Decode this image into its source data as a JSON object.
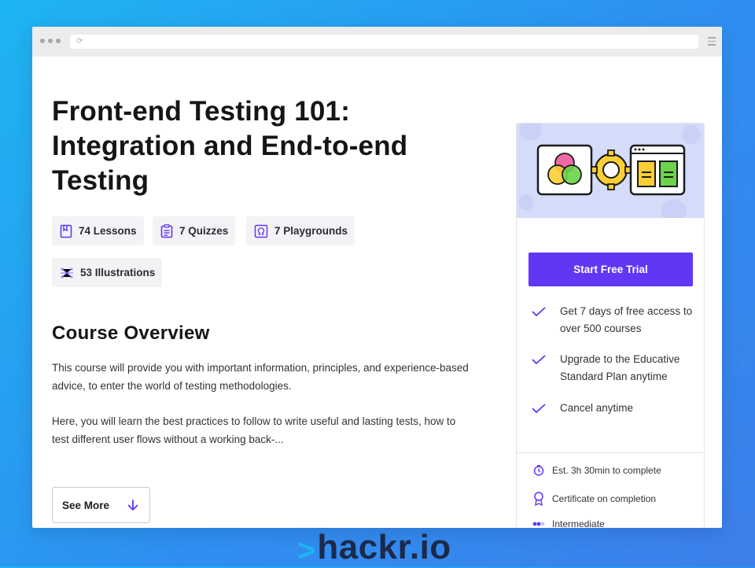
{
  "course": {
    "title": "Front-end Testing 101: Integration and End-to-end Testing",
    "stats": [
      {
        "label": "74 Lessons",
        "icon": "book-icon"
      },
      {
        "label": "7 Quizzes",
        "icon": "quiz-icon"
      },
      {
        "label": "7 Playgrounds",
        "icon": "playground-icon"
      },
      {
        "label": "53 Illustrations",
        "icon": "illustration-icon"
      }
    ]
  },
  "overview": {
    "heading": "Course Overview",
    "paragraph1": "This course will provide you with important information, principles, and experience-based advice, to enter the world of testing methodologies.",
    "paragraph2": "Here, you will learn the best practices to follow to write useful and lasting tests, how to test different user flows without a working back-...",
    "see_more": "See More"
  },
  "sidebar": {
    "cta": "Start Free Trial",
    "benefits": [
      "Get 7 days of free access to over 500 courses",
      "Upgrade to the Educative Standard Plan anytime",
      "Cancel anytime"
    ],
    "meta": [
      {
        "label": "Est. 3h 30min to complete",
        "icon": "clock-icon"
      },
      {
        "label": "Certificate on completion",
        "icon": "certificate-icon"
      },
      {
        "label": "Intermediate",
        "icon": "level-icon"
      }
    ]
  },
  "brand": {
    "logo_caret": ">",
    "logo_text": "hackr.io"
  },
  "colors": {
    "accent": "#6137f5",
    "banner": "#d5dcfa",
    "chip_bg": "#f3f3f6",
    "background_gradient": [
      "#1eb4f2",
      "#3d7fea"
    ]
  }
}
